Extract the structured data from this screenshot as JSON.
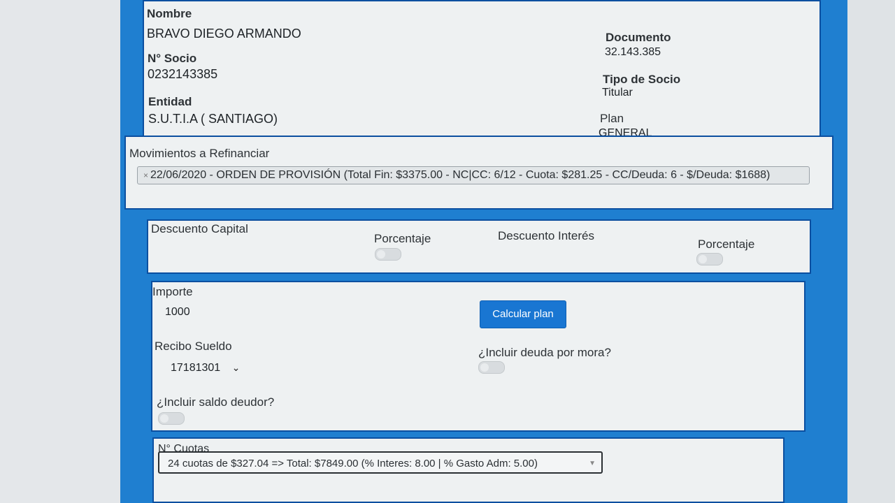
{
  "socio": {
    "nombre_label": "Nombre",
    "nombre_value": "BRAVO DIEGO ARMANDO",
    "nsocio_label": "N° Socio",
    "nsocio_value": "0232143385",
    "entidad_label": "Entidad",
    "entidad_value": "S.U.T.I.A ( SANTIAGO)",
    "documento_label": "Documento",
    "documento_value": "32.143.385",
    "tipo_label": "Tipo de Socio",
    "tipo_value": "Titular",
    "plan_label": "Plan",
    "plan_value": "GENERAL"
  },
  "movimientos": {
    "label": "Movimientos a Refinanciar",
    "chip_remove": "×",
    "chip_text": "22/06/2020 - ORDEN DE PROVISIÓN (Total Fin: $3375.00 - NC|CC: 6/12 - Cuota: $281.25 - CC/Deuda: 6 - $/Deuda: $1688)"
  },
  "descuentos": {
    "capital_label": "Descuento Capital",
    "porcentaje1_label": "Porcentaje",
    "interes_label": "Descuento Interés",
    "porcentaje2_label": "Porcentaje"
  },
  "form": {
    "importe_label": "Importe",
    "importe_value": "1000",
    "calcular_button": "Calcular plan",
    "recibo_label": "Recibo Sueldo",
    "recibo_value": "17181301",
    "incluir_mora_label": "¿Incluir deuda por mora?",
    "incluir_saldo_label": "¿Incluir saldo deudor?"
  },
  "cuotas": {
    "label": "N° Cuotas",
    "selected": "24 cuotas de $327.04 => Total: $7849.00 (% Interes: 8.00 | % Gasto Adm: 5.00)"
  }
}
